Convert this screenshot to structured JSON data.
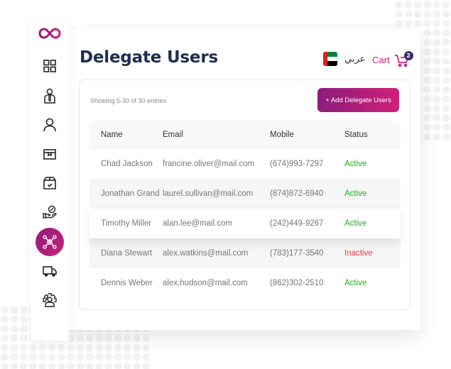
{
  "page": {
    "title": "Delegate Users"
  },
  "brand": {
    "accent": "#c8207a",
    "accent_dark": "#8e1d7a",
    "title_color": "#1d2f4f"
  },
  "sidebar": {
    "logo": "infinity-logo",
    "items": [
      {
        "name": "dashboard",
        "icon": "grid-icon",
        "active": false
      },
      {
        "name": "employees",
        "icon": "person-tie-icon",
        "active": false
      },
      {
        "name": "users",
        "icon": "person-icon",
        "active": false
      },
      {
        "name": "products",
        "icon": "box-icon",
        "active": false
      },
      {
        "name": "orders",
        "icon": "box-check-icon",
        "active": false
      },
      {
        "name": "offers",
        "icon": "hand-discount-icon",
        "active": false
      },
      {
        "name": "delegate-users",
        "icon": "network-user-icon",
        "active": true
      },
      {
        "name": "delivery",
        "icon": "truck-icon",
        "active": false
      },
      {
        "name": "settings",
        "icon": "gear-user-icon",
        "active": false
      }
    ]
  },
  "header": {
    "language_label": "عربي",
    "language_flag": "uae-flag",
    "cart_label": "Cart",
    "cart_count": "2"
  },
  "content": {
    "showing_text": "Showing 5-30 of 30 entries",
    "add_button_label": "+ Add Delegate Users",
    "table": {
      "headers": [
        "Name",
        "Email",
        "Mobile",
        "Status"
      ],
      "rows": [
        {
          "name": "Chad Jackson",
          "email": "francine.oliver@mail.com",
          "mobile": "(674)993-7297",
          "status": "Active"
        },
        {
          "name": "Jonathan Grand",
          "email": "laurel.sullivan@mail.com",
          "mobile": "(874)872-6940",
          "status": "Active"
        },
        {
          "name": "Timothy Miller",
          "email": "alan.lee@mail.com",
          "mobile": "(242)449-9267",
          "status": "Active"
        },
        {
          "name": "Diana Stewart",
          "email": "alex.watkins@mail.com",
          "mobile": "(783)177-3540",
          "status": "Inactive"
        },
        {
          "name": "Dennis Weber",
          "email": "alex.hudson@mail.com",
          "mobile": "(862)302-2510",
          "status": "Active"
        }
      ]
    },
    "status_colors": {
      "Active": "#1bb21b",
      "Inactive": "#e83a3a"
    }
  }
}
